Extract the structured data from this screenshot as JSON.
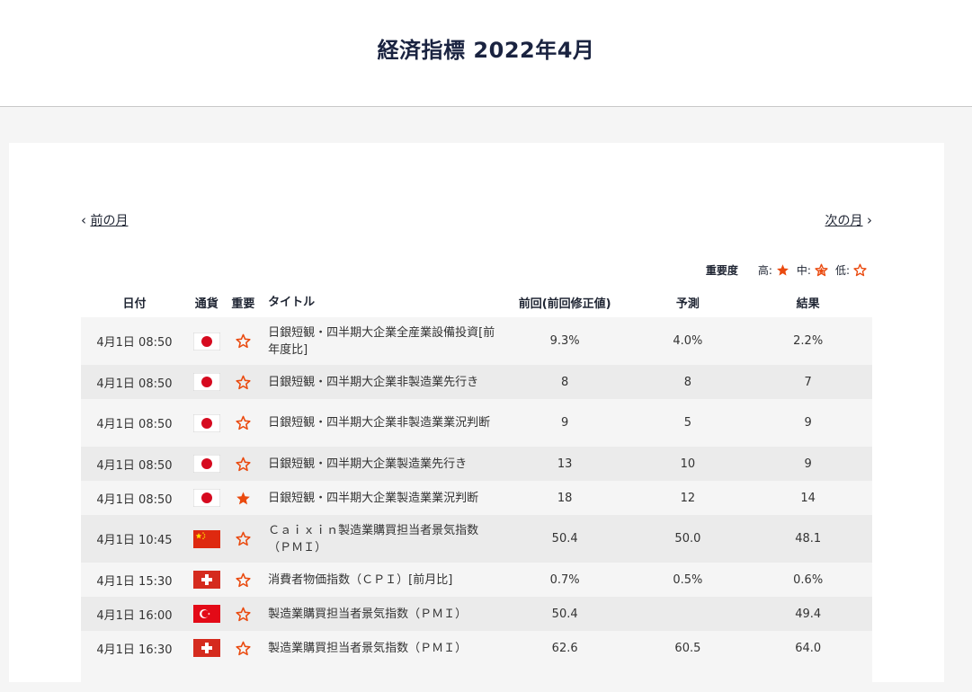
{
  "page": {
    "title": "経済指標 2022年4月"
  },
  "nav": {
    "prev_label": "前の月",
    "prev_chevron": "‹",
    "next_label": "次の月",
    "next_chevron": "›"
  },
  "legend": {
    "title": "重要度",
    "high": "高:",
    "mid": "中:",
    "low": "低:"
  },
  "colors": {
    "star": "#ea4a0f",
    "header_text": "#1a2340",
    "row_odd": "#f5f5f5",
    "row_even": "#ebebeb"
  },
  "table": {
    "headers": {
      "date": "日付",
      "currency": "通貨",
      "importance": "重要",
      "title": "タイトル",
      "previous": "前回(前回修正値)",
      "forecast": "予測",
      "result": "結果"
    },
    "rows": [
      {
        "date": "4月1日 08:50",
        "currency": "jp",
        "importance": "low",
        "title": "日銀短観・四半期大企業全産業設備投資[前年度比]",
        "previous": "9.3%",
        "forecast": "4.0%",
        "result": "2.2%"
      },
      {
        "date": "4月1日 08:50",
        "currency": "jp",
        "importance": "low",
        "title": "日銀短観・四半期大企業非製造業先行き",
        "previous": "8",
        "forecast": "8",
        "result": "7"
      },
      {
        "date": "4月1日 08:50",
        "currency": "jp",
        "importance": "low",
        "title": "日銀短観・四半期大企業非製造業業況判断",
        "previous": "9",
        "forecast": "5",
        "result": "9"
      },
      {
        "date": "4月1日 08:50",
        "currency": "jp",
        "importance": "low",
        "title": "日銀短観・四半期大企業製造業先行き",
        "previous": "13",
        "forecast": "10",
        "result": "9"
      },
      {
        "date": "4月1日 08:50",
        "currency": "jp",
        "importance": "high",
        "title": "日銀短観・四半期大企業製造業業況判断",
        "previous": "18",
        "forecast": "12",
        "result": "14"
      },
      {
        "date": "4月1日 10:45",
        "currency": "cn",
        "importance": "low",
        "title": "Ｃａｉｘｉｎ製造業購買担当者景気指数（ＰＭＩ）",
        "previous": "50.4",
        "forecast": "50.0",
        "result": "48.1"
      },
      {
        "date": "4月1日 15:30",
        "currency": "ch",
        "importance": "low",
        "title": "消費者物価指数（ＣＰＩ）[前月比]",
        "previous": "0.7%",
        "forecast": "0.5%",
        "result": "0.6%"
      },
      {
        "date": "4月1日 16:00",
        "currency": "tr",
        "importance": "low",
        "title": "製造業購買担当者景気指数（ＰＭＩ）",
        "previous": "50.4",
        "forecast": "",
        "result": "49.4"
      },
      {
        "date": "4月1日 16:30",
        "currency": "ch",
        "importance": "low",
        "title": "製造業購買担当者景気指数（ＰＭＩ）",
        "previous": "62.6",
        "forecast": "60.5",
        "result": "64.0"
      }
    ]
  }
}
